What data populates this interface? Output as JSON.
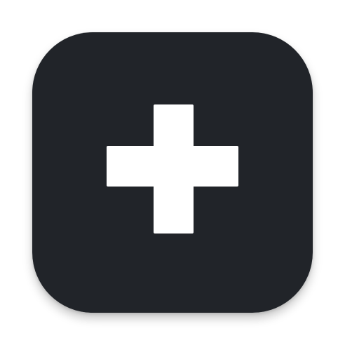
{
  "app_icon": {
    "icon": "plus-icon",
    "background_color": "#212429",
    "glyph_color": "#ffffff"
  }
}
